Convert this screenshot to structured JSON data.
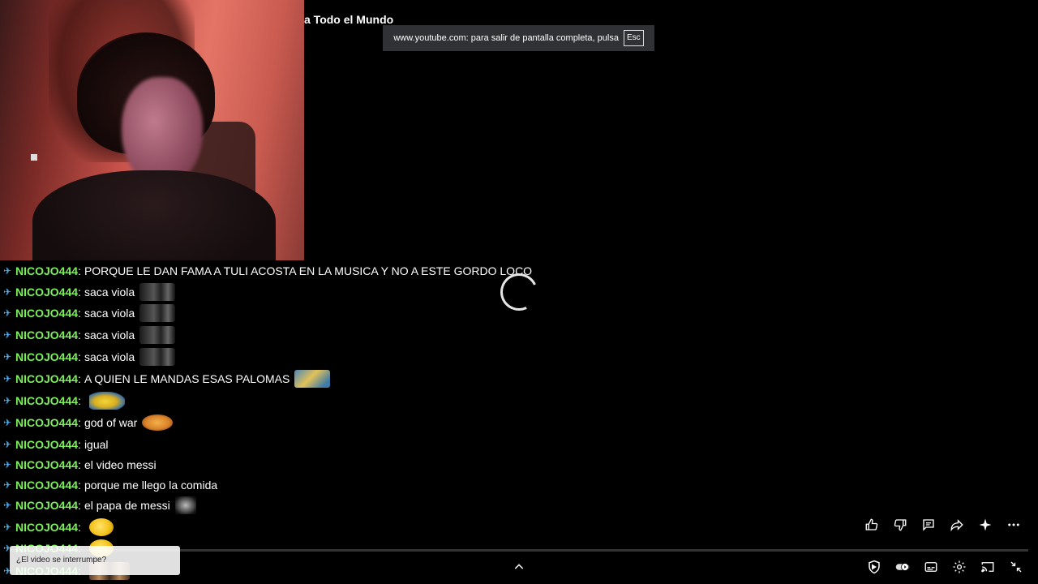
{
  "video": {
    "title_fragment": "a Todo el Mundo"
  },
  "fullscreen_toast": {
    "message": "www.youtube.com: para salir de pantalla completa, pulsa",
    "key": "Esc"
  },
  "chat": {
    "messages": [
      {
        "user": "NICOJO444",
        "text": "PORQUE LE DAN FAMA A TULI ACOSTA EN LA MUSICA Y NO A ESTE GORDO LOCO",
        "emote": ""
      },
      {
        "user": "NICOJO444",
        "text": "saca viola",
        "emote": "dark"
      },
      {
        "user": "NICOJO444",
        "text": "saca viola",
        "emote": "dark"
      },
      {
        "user": "NICOJO444",
        "text": "saca viola",
        "emote": "dark"
      },
      {
        "user": "NICOJO444",
        "text": "saca viola",
        "emote": "dark"
      },
      {
        "user": "NICOJO444",
        "text": "A QUIEN LE MANDAS ESAS PALOMAS",
        "emote": "sponge"
      },
      {
        "user": "NICOJO444",
        "text": "",
        "emote": "bird"
      },
      {
        "user": "NICOJO444",
        "text": "god of war",
        "emote": "laugh"
      },
      {
        "user": "NICOJO444",
        "text": "igual",
        "emote": ""
      },
      {
        "user": "NICOJO444",
        "text": "el video messi",
        "emote": ""
      },
      {
        "user": "NICOJO444",
        "text": "porque me llego la comida",
        "emote": ""
      },
      {
        "user": "NICOJO444",
        "text": "el papa de messi",
        "emote": "ghost"
      },
      {
        "user": "NICOJO444",
        "text": "",
        "emote": "smile"
      },
      {
        "user": "NICOJO444",
        "text": "",
        "emote": "smile"
      },
      {
        "user": "NICOJO444",
        "text": "",
        "emote": "faces"
      }
    ]
  },
  "interrupt_prompt": {
    "text": "¿El video se interrumpe?"
  },
  "actions": [
    {
      "name": "like-icon"
    },
    {
      "name": "dislike-icon"
    },
    {
      "name": "comments-icon"
    },
    {
      "name": "share-icon"
    },
    {
      "name": "ask-ai-icon"
    },
    {
      "name": "more-icon"
    }
  ],
  "controls": [
    {
      "name": "shield-icon"
    },
    {
      "name": "autoplay-toggle-icon"
    },
    {
      "name": "subtitles-icon"
    },
    {
      "name": "settings-gear-icon"
    },
    {
      "name": "cast-icon"
    },
    {
      "name": "exit-fullscreen-icon"
    }
  ],
  "colors": {
    "username": "#7cf05a",
    "pin": "#4ab3f5",
    "toast_bg": "#303134"
  }
}
